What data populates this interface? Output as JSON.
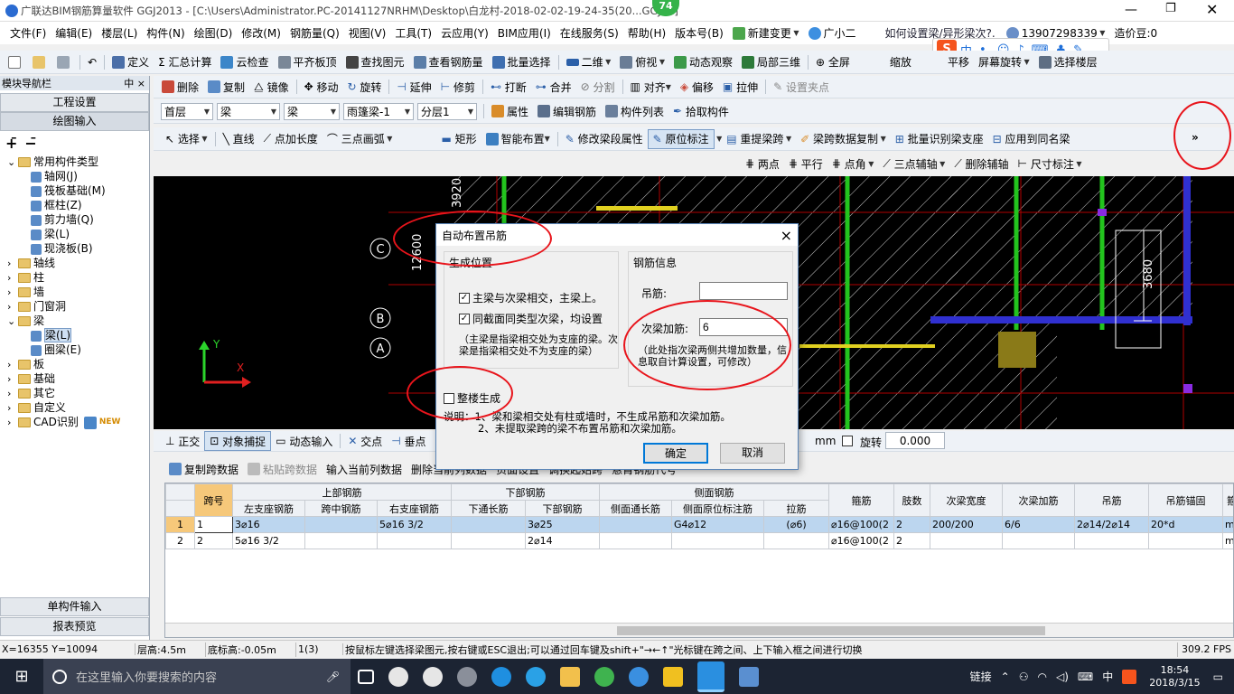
{
  "title": "广联达BIM钢筋算量软件 GGJ2013 - [C:\\Users\\Administrator.PC-20141127NRHM\\Desktop\\白龙村-2018-02-02-19-24-35(20...GGJ12]",
  "title_badge": "74",
  "menu": [
    "文件(F)",
    "编辑(E)",
    "楼层(L)",
    "构件(N)",
    "绘图(D)",
    "修改(M)",
    "钢筋量(Q)",
    "视图(V)",
    "工具(T)",
    "云应用(Y)",
    "BIM应用(I)",
    "在线服务(S)",
    "帮助(H)",
    "版本号(B)",
    "新建变更",
    "广小二"
  ],
  "menu_question": "如何设置梁/异形梁次?.",
  "phone": "13907298339",
  "cost_label": "造价豆:0",
  "toolbar1": [
    "定义",
    "Σ 汇总计算",
    "云检查",
    "平齐板顶",
    "查找图元",
    "查看钢筋量",
    "批量选择",
    "二维",
    "俯视",
    "动态观察",
    "局部三维",
    "全屏",
    "缩放",
    "平移",
    "屏幕旋转",
    "选择楼层"
  ],
  "toolbar2": [
    "删除",
    "复制",
    "镜像",
    "移动",
    "旋转",
    "延伸",
    "修剪",
    "打断",
    "合并",
    "分割",
    "对齐",
    "偏移",
    "拉伸",
    "设置夹点"
  ],
  "toolbar3_combos": [
    "首层",
    "梁",
    "梁",
    "雨篷梁-1",
    "分层1"
  ],
  "toolbar3": [
    "属性",
    "编辑钢筋",
    "构件列表",
    "拾取构件"
  ],
  "toolbar4": [
    "选择",
    "直线",
    "点加长度",
    "三点画弧",
    "矩形",
    "智能布置",
    "修改梁段属性",
    "原位标注",
    "重提梁跨",
    "梁跨数据复制",
    "批量识别梁支座",
    "应用到同名梁"
  ],
  "toolbar4_overflow": "»",
  "toolbar5": [
    "两点",
    "平行",
    "点角",
    "三点辅轴",
    "删除辅轴",
    "尺寸标注"
  ],
  "nav": {
    "title": "模块导航栏",
    "pin": "中 ×",
    "btn_settings": "工程设置",
    "btn_drawing": "绘图输入",
    "tree": [
      {
        "label": "常用构件类型",
        "level": 0,
        "expanded": true
      },
      {
        "label": "轴网(J)",
        "level": 1
      },
      {
        "label": "筏板基础(M)",
        "level": 1
      },
      {
        "label": "框柱(Z)",
        "level": 1
      },
      {
        "label": "剪力墙(Q)",
        "level": 1
      },
      {
        "label": "梁(L)",
        "level": 1
      },
      {
        "label": "现浇板(B)",
        "level": 1
      },
      {
        "label": "轴线",
        "level": 0
      },
      {
        "label": "柱",
        "level": 0
      },
      {
        "label": "墙",
        "level": 0
      },
      {
        "label": "门窗洞",
        "level": 0
      },
      {
        "label": "梁",
        "level": 0,
        "expanded": true
      },
      {
        "label": "梁(L)",
        "level": 1,
        "selected": true
      },
      {
        "label": "圈梁(E)",
        "level": 1
      },
      {
        "label": "板",
        "level": 0
      },
      {
        "label": "基础",
        "level": 0
      },
      {
        "label": "其它",
        "level": 0
      },
      {
        "label": "自定义",
        "level": 0
      },
      {
        "label": "CAD识别",
        "level": 0,
        "badge": "NEW"
      }
    ],
    "btn_single": "单构件输入",
    "btn_report": "报表预览"
  },
  "cad": {
    "axis_labels": [
      "C",
      "B",
      "A"
    ],
    "dims": [
      "3920",
      "12600",
      "3680"
    ],
    "ucs_x": "X",
    "ucs_y": "Y"
  },
  "dialog": {
    "title": "自动布置吊筋",
    "close": "×",
    "gen_position": "生成位置",
    "opt1": "主梁与次梁相交，主梁上。",
    "opt2": "同截面同类型次梁，均设置",
    "note1": "（主梁是指梁相交处为支座的梁。次梁是指梁相交处不为支座的梁）",
    "whole": "整楼生成",
    "rebar_info": "钢筋信息",
    "hanger_label": "吊筋:",
    "hanger_value": "",
    "extra_label": "次梁加筋:",
    "extra_value": "6",
    "note2": "（此处指次梁两侧共增加数量，信息取自计算设置，可修改）",
    "explain": "说明：1、梁和梁相交处有柱或墙时，不生成吊筋和次梁加筋。",
    "explain2": "2、未提取梁跨的梁不布置吊筋和次梁加筋。",
    "ok": "确定",
    "cancel": "取消"
  },
  "snapbar": [
    "正交",
    "对象捕捉",
    "动态输入",
    "交点",
    "垂点"
  ],
  "snap_mm": "mm",
  "snap_rotate": "旋转",
  "snap_angle": "0.000",
  "gridbar": [
    "复制跨数据",
    "粘贴跨数据",
    "输入当前列数据",
    "删除当前列数据",
    "页面设置",
    "调换起始跨",
    "悬臂钢筋代号"
  ],
  "table": {
    "group_headers": [
      "上部钢筋",
      "下部钢筋",
      "侧面钢筋"
    ],
    "headers": [
      "跨号",
      "左支座钢筋",
      "跨中钢筋",
      "右支座钢筋",
      "下通长筋",
      "下部钢筋",
      "侧面通长筋",
      "侧面原位标注筋",
      "拉筋",
      "箍筋",
      "肢数",
      "次梁宽度",
      "次梁加筋",
      "吊筋",
      "吊筋锚固",
      "箍"
    ],
    "rows": [
      [
        "1",
        "1",
        "3⌀16",
        "",
        "5⌀16 3/2",
        "",
        "3⌀25",
        "",
        "G4⌀12",
        "(⌀6)",
        "⌀16@100(2",
        "2",
        "200/200",
        "6/6",
        "2⌀14/2⌀14",
        "20*d",
        "ma"
      ],
      [
        "2",
        "2",
        "5⌀16 3/2",
        "",
        "",
        "",
        "2⌀14",
        "",
        "",
        "",
        "⌀16@100(2",
        "2",
        "",
        "",
        "",
        "",
        "ma"
      ]
    ]
  },
  "status": {
    "coords": "X=16355 Y=10094",
    "floor_h": "层高:4.5m",
    "base_h": "底标高:-0.05m",
    "count": "1(3)",
    "hint": "按鼠标左键选择梁图元,按右键或ESC退出;可以通过回车键及shift+\"→←↑\"光标键在跨之间、上下输入框之间进行切换",
    "fps": "309.2 FPS"
  },
  "taskbar": {
    "search": "在这里输入你要搜索的内容",
    "tray_link": "链接",
    "ime": "中",
    "time": "18:54",
    "date": "2018/3/15"
  },
  "colors": {
    "annotation": "#e8141b",
    "selection": "#bcd6ef",
    "cad_bg": "#000000",
    "taskbar": "#1c2433"
  }
}
